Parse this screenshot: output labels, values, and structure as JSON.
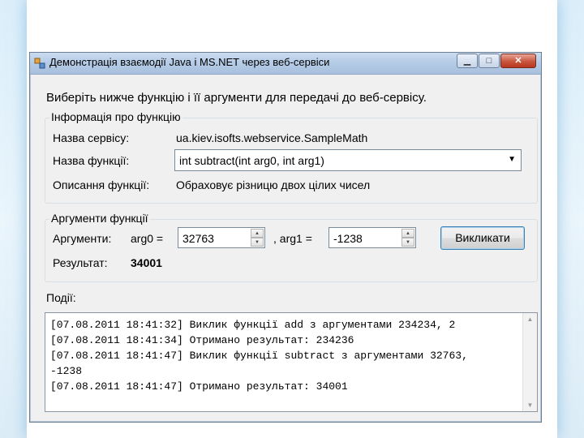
{
  "window": {
    "title": "Демонстрація взаємодії Java і MS.NET через веб-сервіси",
    "minimize_glyph": "▁",
    "maximize_glyph": "□",
    "close_glyph": "✕"
  },
  "instruction": "Виберіть нижче функцію і її аргументи для передачі до веб-сервісу.",
  "info_group": {
    "title": "Інформація про функцію",
    "service_label": "Назва сервісу:",
    "service_value": "ua.kiev.isofts.webservice.SampleMath",
    "function_label": "Назва функції:",
    "function_selected": "int subtract(int arg0, int arg1)",
    "description_label": "Описання функції:",
    "description_value": "Обраховує різницю двох цілих чисел"
  },
  "args_group": {
    "title": "Аргументи функції",
    "args_label": "Аргументи:",
    "arg0_label": "arg0 =",
    "arg0_value": "32763",
    "separator": ", arg1 =",
    "arg1_value": "-1238",
    "call_button": "Викликати",
    "result_label": "Результат:",
    "result_value": "34001"
  },
  "events": {
    "label": "Події:",
    "lines": [
      "[07.08.2011 18:41:32] Виклик функції add з аргументами 234234, 2",
      "[07.08.2011 18:41:34] Отримано результат: 234236",
      "[07.08.2011 18:41:47] Виклик функції subtract з аргументами 32763,",
      "-1238",
      "[07.08.2011 18:41:47] Отримано результат: 34001"
    ]
  },
  "colors": {
    "titlebar": "#b4cbe6",
    "close_button": "#c9553d",
    "window_bg": "#f0f0f0"
  }
}
